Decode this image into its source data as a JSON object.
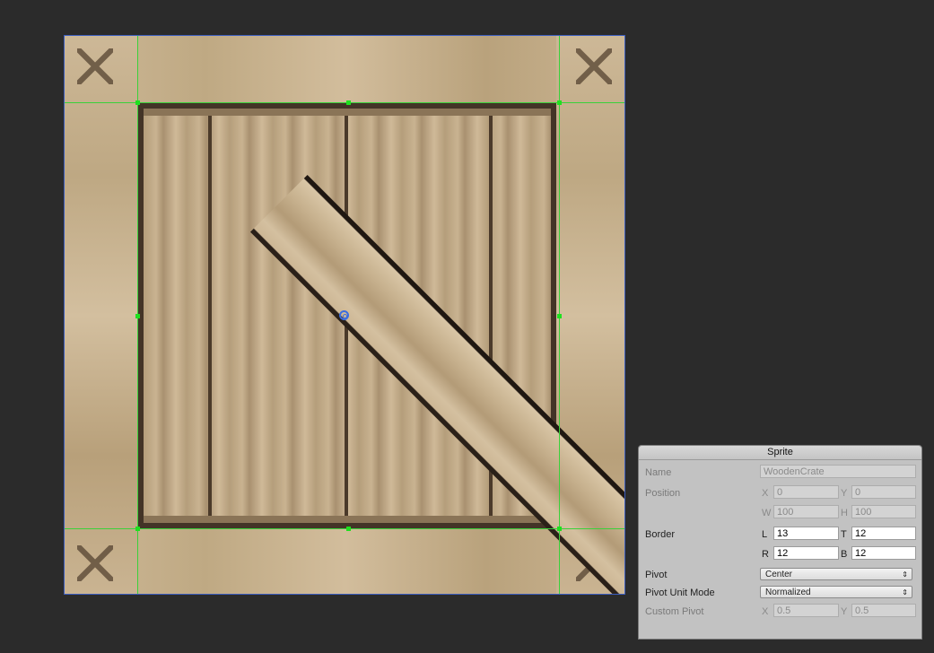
{
  "sprite": {
    "name": "WoodenCrate"
  },
  "panel": {
    "title": "Sprite",
    "name_label": "Name",
    "name_value": "WoodenCrate",
    "position_label": "Position",
    "position": {
      "x_label": "X",
      "x": "0",
      "y_label": "Y",
      "y": "0",
      "w_label": "W",
      "w": "100",
      "h_label": "H",
      "h": "100"
    },
    "border_label": "Border",
    "border": {
      "l_label": "L",
      "l": "13",
      "t_label": "T",
      "t": "12",
      "r_label": "R",
      "r": "12",
      "b_label": "B",
      "b": "12"
    },
    "pivot_label": "Pivot",
    "pivot_value": "Center",
    "pivot_unit_label": "Pivot Unit Mode",
    "pivot_unit_value": "Normalized",
    "custom_pivot_label": "Custom Pivot",
    "custom_pivot": {
      "x_label": "X",
      "x": "0.5",
      "y_label": "Y",
      "y": "0.5"
    }
  },
  "colors": {
    "guide": "#3ad13a",
    "selection": "#3b5dbf",
    "pivot": "#3b6de0"
  },
  "icons": {
    "dropdown": "updown-arrow-icon",
    "pivot": "pivot-handle-icon"
  }
}
